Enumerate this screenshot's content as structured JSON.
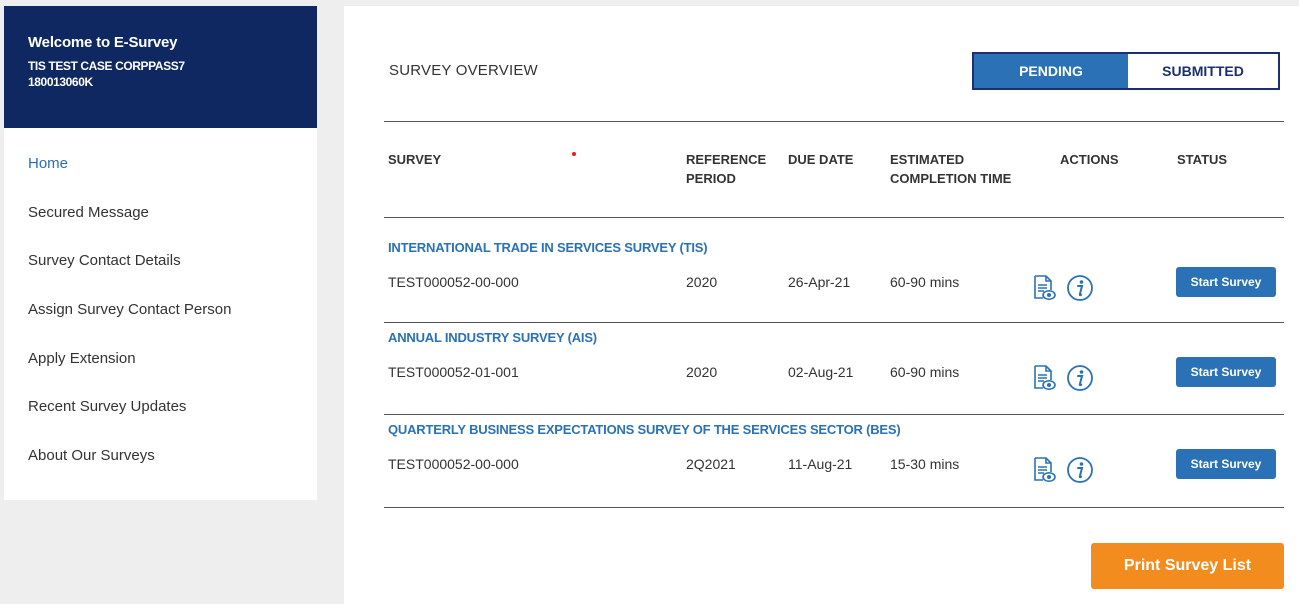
{
  "sidebar": {
    "welcome": "Welcome to E-Survey",
    "company_name": "TIS TEST CASE CORPPASS7",
    "company_id": "180013060K",
    "items": [
      {
        "label": "Home",
        "active": true
      },
      {
        "label": "Secured Message"
      },
      {
        "label": "Survey Contact Details"
      },
      {
        "label": "Assign Survey Contact Person"
      },
      {
        "label": "Apply Extension"
      },
      {
        "label": "Recent Survey Updates"
      },
      {
        "label": "About Our Surveys"
      }
    ]
  },
  "main": {
    "title": "SURVEY OVERVIEW",
    "tabs": [
      {
        "label": "PENDING",
        "active": true
      },
      {
        "label": "SUBMITTED",
        "active": false
      }
    ],
    "columns": {
      "survey": "SURVEY",
      "reference_period_1": "REFERENCE",
      "reference_period_2": "PERIOD",
      "due_date": "DUE DATE",
      "completion_1": "ESTIMATED",
      "completion_2": "COMPLETION TIME",
      "actions": "ACTIONS",
      "status": "STATUS"
    },
    "rows": [
      {
        "name": "INTERNATIONAL TRADE IN SERVICES SURVEY (TIS)",
        "id": "TEST000052-00-000",
        "reference_period": "2020",
        "due_date": "26-Apr-21",
        "completion_time": "60-90 mins",
        "status_button": "Start Survey"
      },
      {
        "name": "ANNUAL INDUSTRY SURVEY (AIS)",
        "id": "TEST000052-01-001",
        "reference_period": "2020",
        "due_date": "02-Aug-21",
        "completion_time": "60-90 mins",
        "status_button": "Start Survey"
      },
      {
        "name": "QUARTERLY BUSINESS EXPECTATIONS SURVEY OF THE SERVICES SECTOR (BES)",
        "id": "TEST000052-00-000",
        "reference_period": "2Q2021",
        "due_date": "11-Aug-21",
        "completion_time": "15-30 mins",
        "status_button": "Start Survey"
      }
    ],
    "print_button": "Print Survey List"
  },
  "colors": {
    "navy": "#0f2862",
    "accent_blue": "#2a72b5",
    "orange": "#f28c1f"
  }
}
